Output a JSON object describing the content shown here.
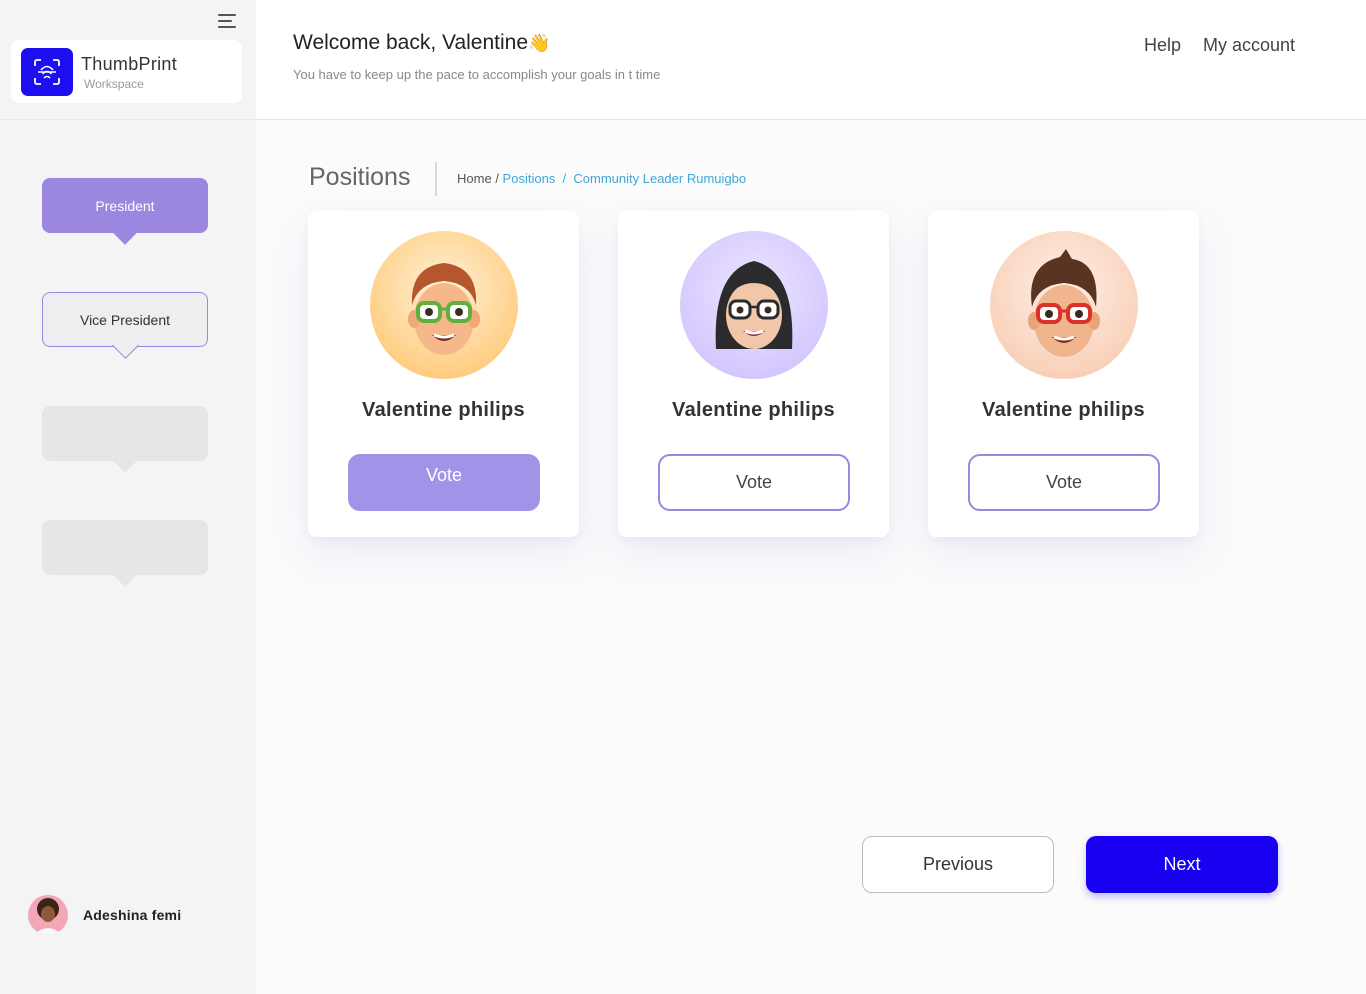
{
  "sidebar": {
    "brand": {
      "name": "ThumbPrint",
      "subtitle": "Workspace"
    },
    "positions": [
      {
        "label": "President",
        "state": "active"
      },
      {
        "label": "Vice President",
        "state": "outlined"
      },
      {
        "label": "",
        "state": "empty"
      },
      {
        "label": "",
        "state": "empty"
      }
    ],
    "user": {
      "name": "Adeshina femi"
    }
  },
  "header": {
    "welcome": "Welcome back, Valentine",
    "welcome_emoji": "👋",
    "subtitle": "You have to keep up the pace to accomplish your goals in t time",
    "nav": {
      "help": "Help",
      "account": "My account"
    }
  },
  "main": {
    "title": "Positions",
    "breadcrumb": {
      "home": "Home",
      "positions": "Positions",
      "current": "Community Leader Rumuigbo"
    },
    "candidates": [
      {
        "name": "Valentine philips",
        "vote_label": "Vote",
        "vote_style": "filled",
        "avatar": "memoji-green-glasses-icon"
      },
      {
        "name": "Valentine philips",
        "vote_label": "Vote",
        "vote_style": "outline",
        "avatar": "memoji-woman-glasses-icon"
      },
      {
        "name": "Valentine philips",
        "vote_label": "Vote",
        "vote_style": "outline",
        "avatar": "memoji-red-glasses-icon"
      }
    ],
    "pagination": {
      "previous": "Previous",
      "next": "Next"
    }
  },
  "colors": {
    "accent": "#9b87e0",
    "primary": "#1a00f0",
    "link": "#3fa7d6"
  }
}
